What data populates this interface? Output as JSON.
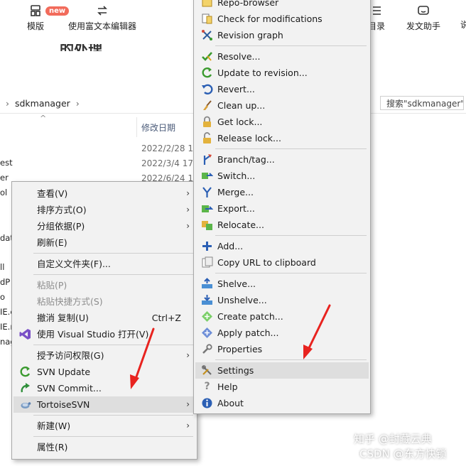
{
  "toolbar": {
    "template_label": "模版",
    "new_badge": "new",
    "rich_editor_label": "使用富文本编辑器",
    "directory_label": "目录",
    "publish_assistant_label": "发文助手",
    "right_edge_label": "说"
  },
  "doc_title_fragment": "的处理",
  "explorer": {
    "address": "sdkmanager",
    "search_placeholder": "搜索\"sdkmanager\"",
    "column_modified": "修改日期",
    "dates": [
      "2022/2/28 1",
      "2022/3/4 17",
      "2022/6/24 1"
    ],
    "file_stubs": [
      "est",
      "er",
      "ol",
      "dat",
      "ll",
      "dP",
      "o",
      "IE.e",
      "IE.r",
      "nag"
    ]
  },
  "context_menu": {
    "items": [
      {
        "label": "查看(V)",
        "submenu": true
      },
      {
        "label": "排序方式(O)",
        "submenu": true
      },
      {
        "label": "分组依据(P)",
        "submenu": true
      },
      {
        "label": "刷新(E)"
      },
      {
        "label": "自定义文件夹(F)..."
      },
      {
        "label": "粘贴(P)",
        "disabled": true
      },
      {
        "label": "粘贴快捷方式(S)",
        "disabled": true
      },
      {
        "label": "撤消 复制(U)",
        "shortcut": "Ctrl+Z"
      },
      {
        "label": "使用 Visual Studio 打开(V)"
      },
      {
        "label": "授予访问权限(G)",
        "submenu": true
      },
      {
        "label": "SVN Update"
      },
      {
        "label": "SVN Commit..."
      },
      {
        "label": "TortoiseSVN",
        "submenu": true,
        "highlighted": true
      },
      {
        "label": "新建(W)",
        "submenu": true
      },
      {
        "label": "属性(R)"
      }
    ]
  },
  "tortoise_menu": {
    "items": [
      {
        "label": "Repo-browser"
      },
      {
        "label": "Check for modifications"
      },
      {
        "label": "Revision graph"
      },
      {
        "label": "Resolve..."
      },
      {
        "label": "Update to revision..."
      },
      {
        "label": "Revert..."
      },
      {
        "label": "Clean up..."
      },
      {
        "label": "Get lock..."
      },
      {
        "label": "Release lock..."
      },
      {
        "label": "Branch/tag..."
      },
      {
        "label": "Switch..."
      },
      {
        "label": "Merge..."
      },
      {
        "label": "Export..."
      },
      {
        "label": "Relocate..."
      },
      {
        "label": "Add..."
      },
      {
        "label": "Copy URL to clipboard"
      },
      {
        "label": "Shelve..."
      },
      {
        "label": "Unshelve..."
      },
      {
        "label": "Create patch..."
      },
      {
        "label": "Apply patch..."
      },
      {
        "label": "Properties"
      },
      {
        "label": "Settings",
        "highlighted": true
      },
      {
        "label": "Help"
      },
      {
        "label": "About"
      }
    ]
  },
  "watermark": {
    "zhihu": "知乎 @封藏云典",
    "csdn": "CSDN @东方快锁"
  },
  "colors": {
    "menu_bg": "#f2f2f2",
    "highlight": "#dedede",
    "annotation_arrow": "#e8231f",
    "badge": "#f26b5b"
  }
}
